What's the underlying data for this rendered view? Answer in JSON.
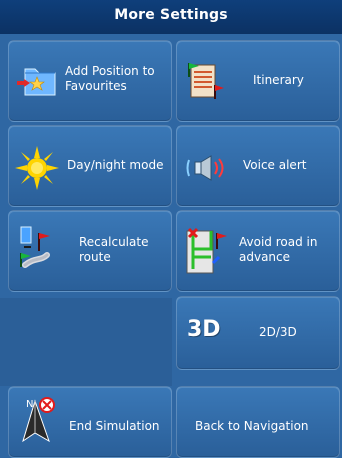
{
  "header": {
    "title": "More Settings"
  },
  "tiles": {
    "add_favourites": "Add Position to\nFavourites",
    "itinerary": "Itinerary",
    "day_night": "Day/night mode",
    "voice_alert": "Voice alert",
    "recalculate_route": "Recalculate\nroute",
    "avoid_road": "Avoid road in\nadvance",
    "toggle_2d3d": {
      "icon_text": "3D",
      "label": "2D/3D"
    },
    "end_simulation": "End Simulation",
    "back_to_navigation": "Back to Navigation"
  }
}
